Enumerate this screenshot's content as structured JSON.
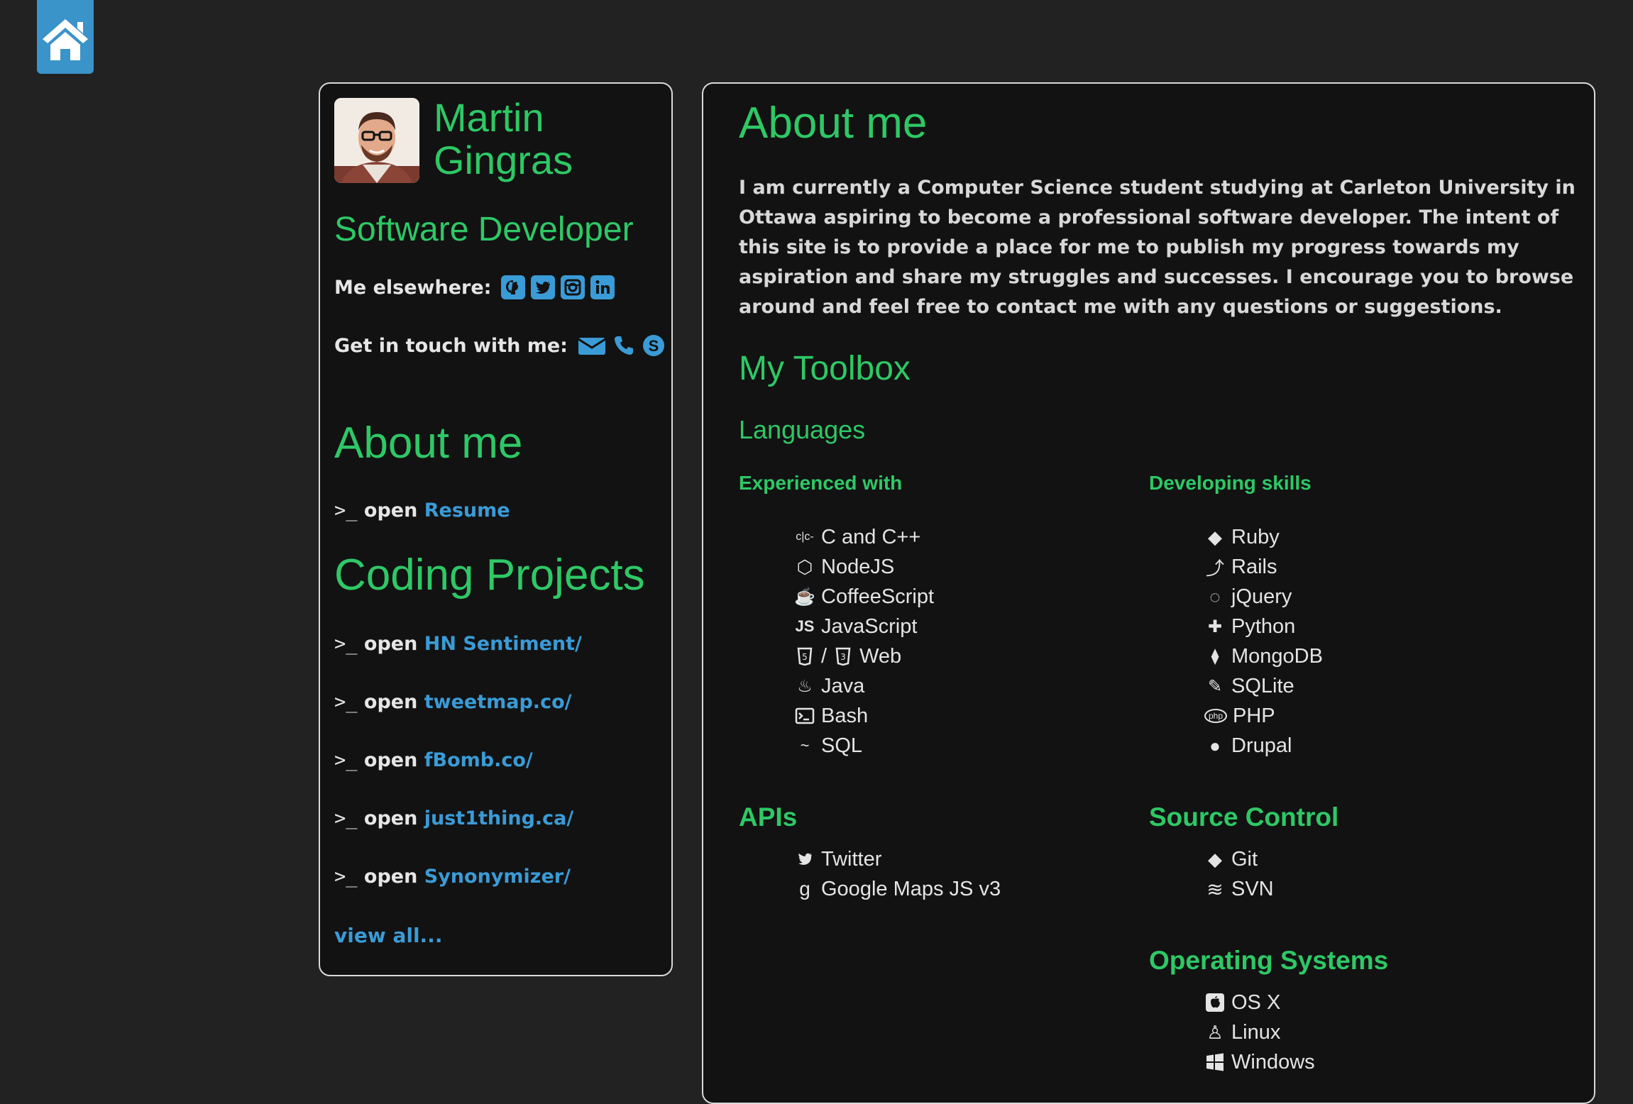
{
  "colors": {
    "accent": "#2ec866",
    "link": "#3a9bd6",
    "home": "#3a93c9",
    "background": "#222222",
    "card": "#121212"
  },
  "home": {
    "icon": "home-icon"
  },
  "profile": {
    "first_name": "Martin",
    "last_name": "Gingras",
    "role": "Software Developer",
    "elsewhere_label": "Me elsewhere:",
    "elsewhere_icons": [
      "github-icon",
      "twitter-icon",
      "instagram-icon",
      "linkedin-icon"
    ],
    "contact_label": "Get in touch with me:",
    "contact_icons": [
      "mail-icon",
      "phone-icon",
      "skype-icon"
    ]
  },
  "sidebar": {
    "about_heading": "About me",
    "prompt": ">_",
    "open_word": "open",
    "resume_link": "Resume",
    "projects_heading": "Coding Projects",
    "projects": [
      "HN Sentiment/",
      "tweetmap.co/",
      "fBomb.co/",
      "just1thing.ca/",
      "Synonymizer/"
    ],
    "view_all": "view all..."
  },
  "main": {
    "heading": "About me",
    "intro": "I am currently a Computer Science student studying at Carleton University in Ottawa aspiring to become a professional software developer. The intent of this site is to provide a place for me to publish my progress towards my aspiration and share my struggles and successes. I encourage you to browse around and feel free to contact me with any questions or suggestions.",
    "toolbox_heading": "My Toolbox",
    "languages_heading": "Languages",
    "experienced_heading": "Experienced with",
    "experienced": [
      {
        "label": "C and C++",
        "icon": "c-icon",
        "glyph": "c|c-"
      },
      {
        "label": "NodeJS",
        "icon": "nodejs-icon",
        "glyph": "⬡"
      },
      {
        "label": "CoffeeScript",
        "icon": "coffeescript-icon",
        "glyph": "☕"
      },
      {
        "label": "JavaScript",
        "icon": "javascript-icon",
        "glyph": "JS"
      },
      {
        "label": "/",
        "label2": "Web",
        "icon": "html5-css3-icon",
        "glyph": "5"
      },
      {
        "label": "Java",
        "icon": "java-icon",
        "glyph": "♨"
      },
      {
        "label": "Bash",
        "icon": "terminal-icon",
        "glyph": ">_"
      },
      {
        "label": "SQL",
        "icon": "mysql-icon",
        "glyph": "~"
      }
    ],
    "developing_heading": "Developing skills",
    "developing": [
      {
        "label": "Ruby",
        "icon": "ruby-icon",
        "glyph": "◆"
      },
      {
        "label": "Rails",
        "icon": "rails-icon",
        "glyph": "⤴"
      },
      {
        "label": "jQuery",
        "icon": "jquery-icon",
        "glyph": "◌"
      },
      {
        "label": "Python",
        "icon": "python-icon",
        "glyph": "✚"
      },
      {
        "label": "MongoDB",
        "icon": "mongodb-icon",
        "glyph": "⧫"
      },
      {
        "label": "SQLite",
        "icon": "sqlite-icon",
        "glyph": "✎"
      },
      {
        "label": "PHP",
        "icon": "php-icon",
        "glyph": "php"
      },
      {
        "label": "Drupal",
        "icon": "drupal-icon",
        "glyph": "●"
      }
    ],
    "apis_heading": "APIs",
    "apis": [
      {
        "label": "Twitter",
        "icon": "twitter-icon"
      },
      {
        "label": "Google Maps JS v3",
        "icon": "google-icon",
        "glyph": "g"
      }
    ],
    "source_control_heading": "Source Control",
    "source_control": [
      {
        "label": "Git",
        "icon": "git-icon",
        "glyph": "◆"
      },
      {
        "label": "SVN",
        "icon": "svn-icon",
        "glyph": "≋"
      }
    ],
    "os_heading": "Operating Systems",
    "os": [
      {
        "label": "OS X",
        "icon": "apple-icon",
        "glyph": ""
      },
      {
        "label": "Linux",
        "icon": "linux-icon",
        "glyph": "♙"
      },
      {
        "label": "Windows",
        "icon": "windows-icon",
        "glyph": "⊞"
      }
    ]
  }
}
